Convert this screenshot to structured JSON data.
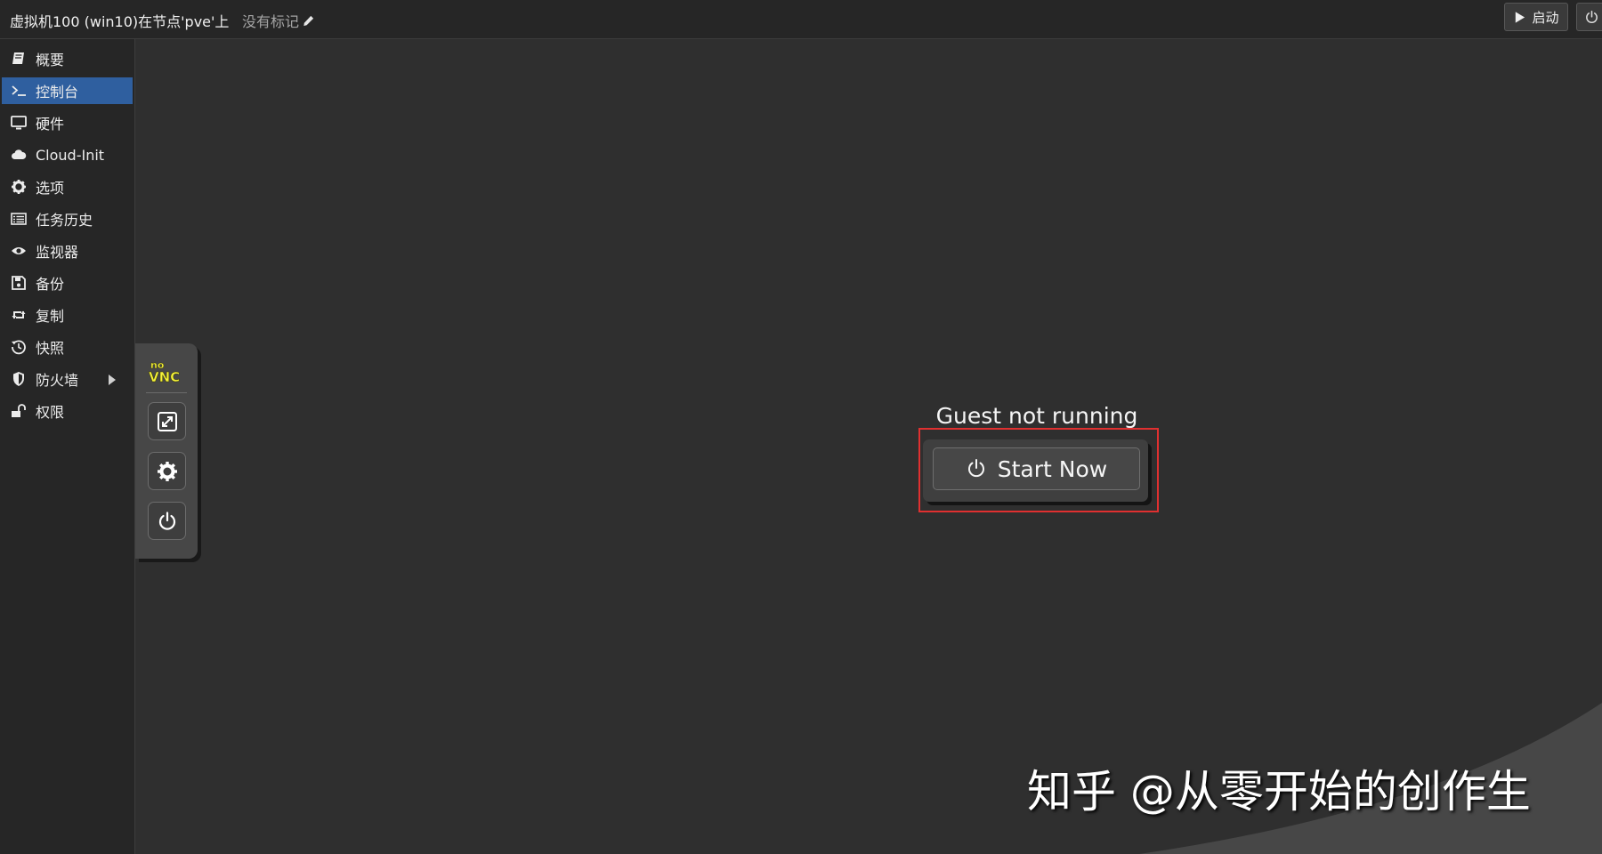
{
  "header": {
    "vm_title": "虚拟机100 (win10)在节点'pve'上",
    "tags_label": "没有标记",
    "start_label": "启动"
  },
  "sidebar": {
    "items": [
      {
        "label": "概要",
        "icon": "book-icon"
      },
      {
        "label": "控制台",
        "icon": "terminal-icon",
        "active": true
      },
      {
        "label": "硬件",
        "icon": "desktop-icon"
      },
      {
        "label": "Cloud-Init",
        "icon": "cloud-icon"
      },
      {
        "label": "选项",
        "icon": "gear-icon"
      },
      {
        "label": "任务历史",
        "icon": "list-icon"
      },
      {
        "label": "监视器",
        "icon": "eye-icon"
      },
      {
        "label": "备份",
        "icon": "floppy-icon"
      },
      {
        "label": "复制",
        "icon": "retweet-icon"
      },
      {
        "label": "快照",
        "icon": "history-icon"
      },
      {
        "label": "防火墙",
        "icon": "shield-icon",
        "expandable": true
      },
      {
        "label": "权限",
        "icon": "unlock-icon"
      }
    ]
  },
  "novnc": {
    "logo_no": "no",
    "logo_vnc": "VNC",
    "buttons": [
      "fullscreen-icon",
      "settings-gear-icon",
      "power-icon"
    ]
  },
  "console": {
    "status_text": "Guest not running",
    "start_now_label": "Start Now"
  },
  "watermark": {
    "text": "知乎 @从零开始的创作生"
  },
  "colors": {
    "background": "#2f2f2f",
    "sidebar_active": "#2f5f9f",
    "highlight_box": "#e03030",
    "novnc_logo_yellow": "#f6f33b"
  }
}
